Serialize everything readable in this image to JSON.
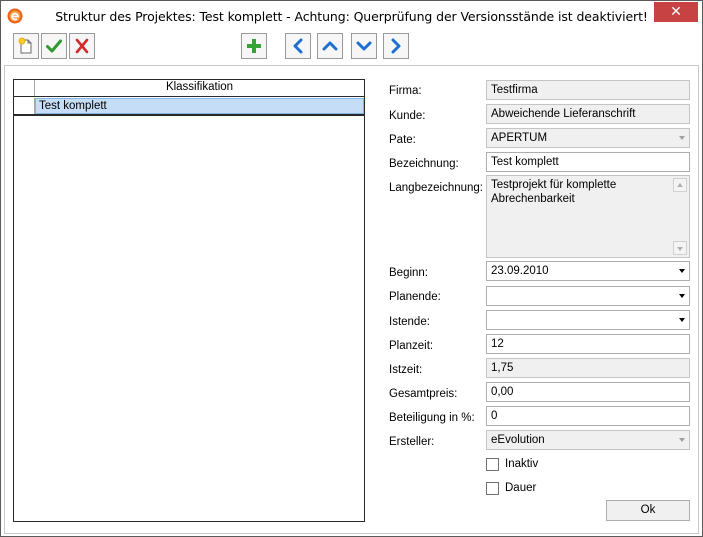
{
  "window": {
    "title": "Struktur des Projektes: Test komplett  - Achtung: Querprüfung der Versionsstände ist deaktiviert!",
    "close_label": "✕"
  },
  "toolbar": {
    "buttons": [
      {
        "name": "new-icon"
      },
      {
        "name": "save-checkmark-icon"
      },
      {
        "name": "cancel-x-icon"
      },
      {
        "name": "add-plus-icon"
      },
      {
        "name": "arrow-left-icon"
      },
      {
        "name": "arrow-up-icon"
      },
      {
        "name": "arrow-down-icon"
      },
      {
        "name": "arrow-right-icon"
      }
    ]
  },
  "grid": {
    "column_header": "Klassifikation",
    "rows": [
      {
        "label": "Test komplett",
        "selected": true
      }
    ]
  },
  "form": {
    "firma": {
      "label": "Firma:",
      "value": "Testfirma"
    },
    "kunde": {
      "label": "Kunde:",
      "value": "Abweichende Lieferanschrift"
    },
    "pate": {
      "label": "Pate:",
      "value": "APERTUM"
    },
    "bezeichnung": {
      "label": "Bezeichnung:",
      "value": "Test komplett"
    },
    "langbezeichnung": {
      "label": "Langbezeichnung:",
      "value": "Testprojekt für komplette Abrechenbarkeit"
    },
    "beginn": {
      "label": "Beginn:",
      "value": "23.09.2010"
    },
    "planende": {
      "label": "Planende:",
      "value": ""
    },
    "istende": {
      "label": "Istende:",
      "value": ""
    },
    "planzeit": {
      "label": "Planzeit:",
      "value": "12"
    },
    "istzeit": {
      "label": "Istzeit:",
      "value": "1,75"
    },
    "gesamtpreis": {
      "label": "Gesamtpreis:",
      "value": "0,00"
    },
    "beteiligung": {
      "label": "Beteiligung in %:",
      "value": "0"
    },
    "ersteller": {
      "label": "Ersteller:",
      "value": "eEvolution"
    },
    "inaktiv": {
      "label": "Inaktiv",
      "checked": false
    },
    "dauer": {
      "label": "Dauer",
      "checked": false
    }
  },
  "buttons": {
    "ok_label": "Ok"
  },
  "colors": {
    "selection": "#c5ddf6",
    "close_button": "#c74242",
    "readonly_bg": "#f0f0f0"
  }
}
